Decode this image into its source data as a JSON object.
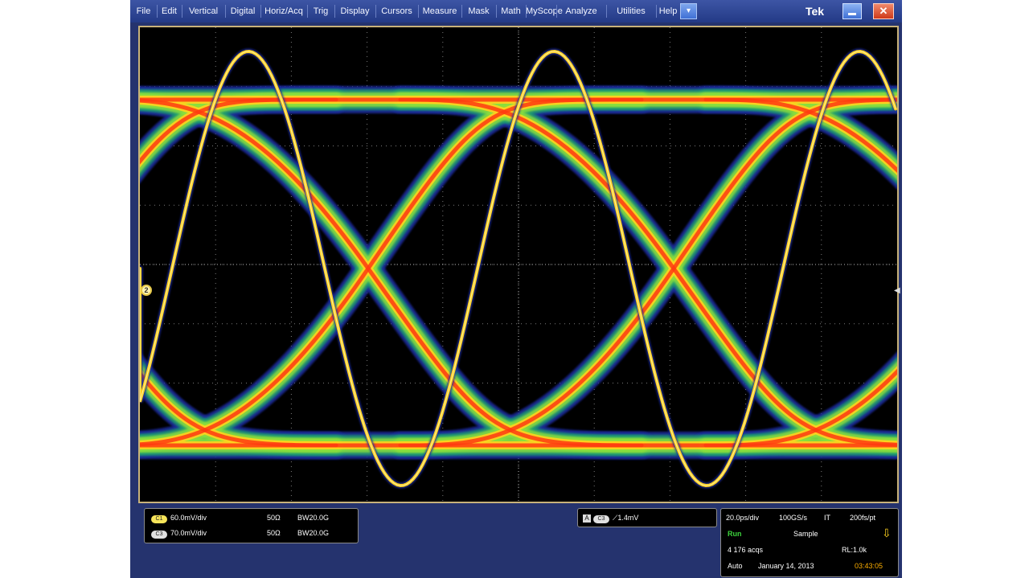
{
  "menu": [
    "File",
    "Edit",
    "Vertical",
    "Digital",
    "Horiz/Acq",
    "Trig",
    "Display",
    "Cursors",
    "Measure",
    "Mask",
    "Math",
    "MyScope",
    "Analyze",
    "Utilities",
    "Help"
  ],
  "brand": "Tek",
  "icons": {
    "dropdown": "chevron-down-icon",
    "minimize": "minimize-icon",
    "close": "close-icon",
    "channel": "channel-2-marker-icon",
    "trigger_level": "trigger-level-arrow-icon",
    "trigger_slope": "rising-edge-icon",
    "trigger_status": "trigger-status-arrow-icon"
  },
  "colors": {
    "menubar": "#2f4798",
    "graticule_border": "#c8b27a",
    "trace_hot": "#ff3a10",
    "trace_warm": "#ffd21e",
    "trace_cool": "#30c040",
    "trace_edge": "#1a2a9a",
    "status_run": "#3cd23c",
    "clock": "#ffb000"
  },
  "channels": [
    {
      "badge": "C1",
      "badge_color": "#f7e45a",
      "scale": "60.0mV/div",
      "impedance": "50Ω",
      "bandwidth": "BW20.0G"
    },
    {
      "badge": "C3",
      "badge_color": "#e0e0e0",
      "scale": "70.0mV/div",
      "impedance": "50Ω",
      "bandwidth": "BW20.0G"
    }
  ],
  "trigger": {
    "source": "C3",
    "source_color": "#e0e0e0",
    "label": "A",
    "level": "1.4mV"
  },
  "acquisition": {
    "timebase": "20.0ps/div",
    "sample_rate": "100GS/s",
    "mode": "IT",
    "resolution": "200fs/pt",
    "state": "Run",
    "acq_mode": "Sample",
    "acq_count": "4 176 acqs",
    "record_length": "RL:1.0k",
    "trigger_mode": "Auto",
    "date": "January 14, 2013",
    "time": "03:43:05"
  },
  "channel_marker": "2"
}
